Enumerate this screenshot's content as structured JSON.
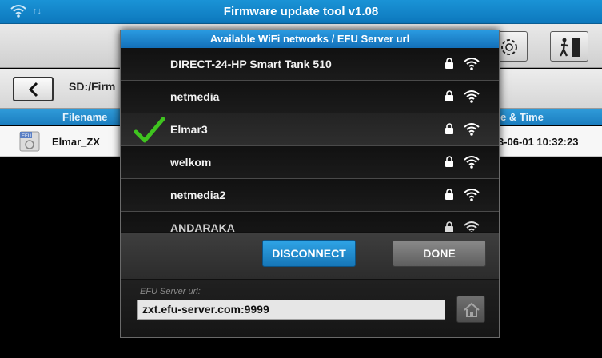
{
  "topbar": {
    "title": "Firmware update tool v1.08",
    "status_icons": [
      "wifi-icon",
      "arrows-icon"
    ],
    "arrows_glyph": "↑↓"
  },
  "toolbar": {
    "buttons": [
      "settings-icon",
      "exit-icon"
    ]
  },
  "pathbar": {
    "back_icon": "chevron-left-icon",
    "path": "SD:/Firm"
  },
  "file_table": {
    "columns": [
      "Filename",
      "e & Time"
    ],
    "rows": [
      {
        "icon": "efu-file-icon",
        "icon_label": "EFU",
        "filename": "Elmar_ZX",
        "datetime": "3-06-01 10:32:23"
      }
    ]
  },
  "wifi_dialog": {
    "title": "Available WiFi networks / EFU Server url",
    "networks": [
      {
        "name": "DIRECT-24-HP Smart Tank 510",
        "locked": true,
        "selected": false
      },
      {
        "name": "netmedia",
        "locked": true,
        "selected": false
      },
      {
        "name": "Elmar3",
        "locked": true,
        "selected": true
      },
      {
        "name": "welkom",
        "locked": true,
        "selected": false
      },
      {
        "name": "netmedia2",
        "locked": true,
        "selected": false
      },
      {
        "name": "ANDARAKA",
        "locked": true,
        "selected": false
      }
    ],
    "disconnect_label": "DISCONNECT",
    "done_label": "DONE",
    "server_label": "EFU Server url:",
    "server_value": "zxt.efu-server.com:9999"
  },
  "colors": {
    "accent": "#1a7dbf",
    "check": "#3fc41f"
  }
}
